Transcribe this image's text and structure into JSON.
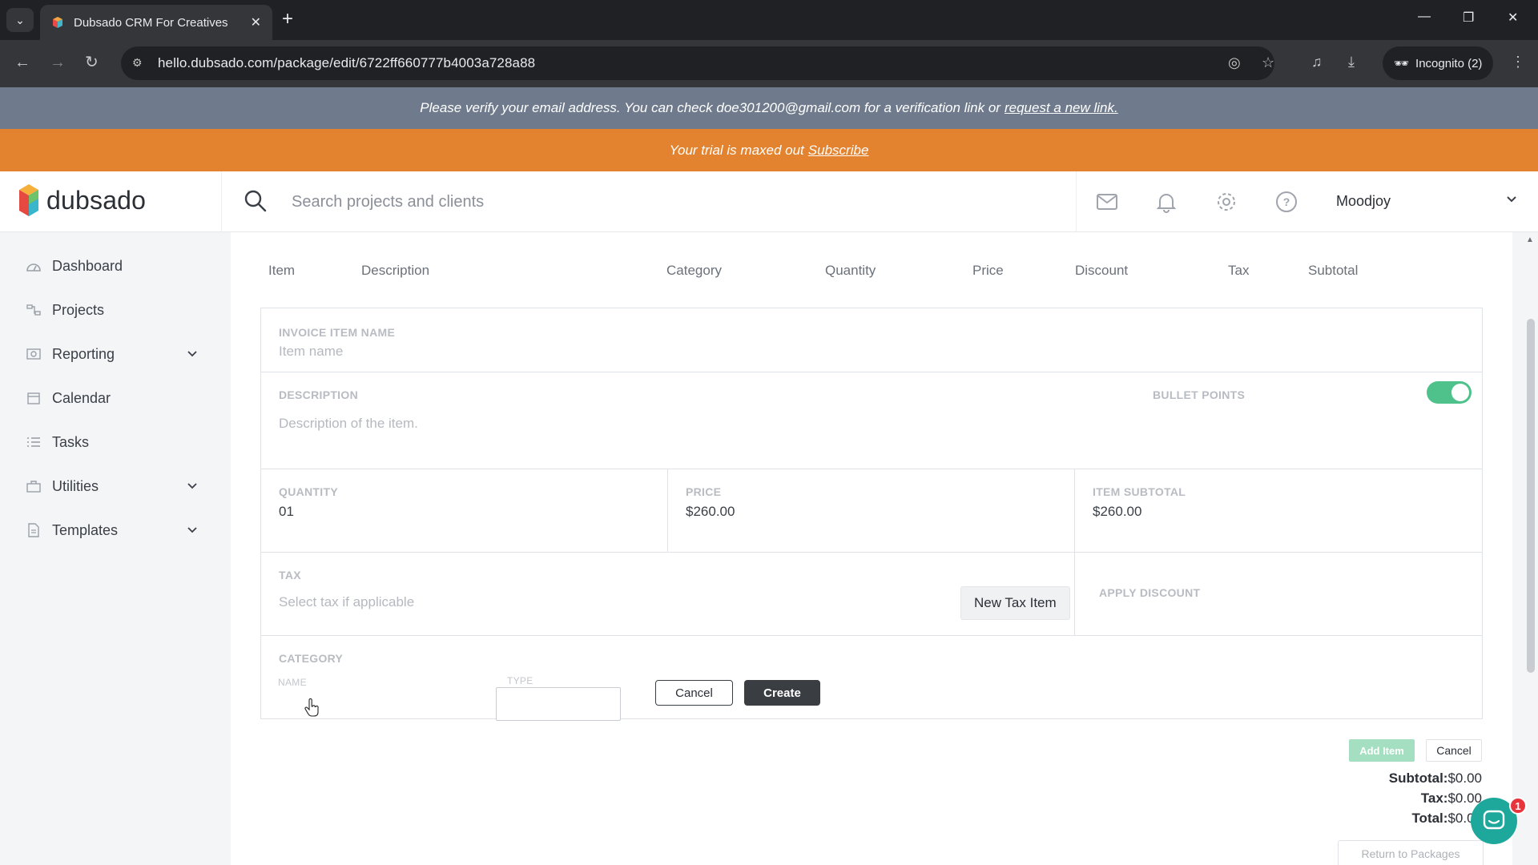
{
  "browser": {
    "tab_title": "Dubsado CRM For Creatives",
    "url": "hello.dubsado.com/package/edit/6722ff660777b4003a728a88",
    "incognito_label": "Incognito (2)"
  },
  "banners": {
    "verify_text": "Please verify your email address. You can check doe301200@gmail.com for a verification link or",
    "verify_link": "request a new link.",
    "trial_text": "Your trial is maxed out",
    "trial_link": "Subscribe"
  },
  "header": {
    "logo_text": "dubsado",
    "search_placeholder": "Search projects and clients",
    "user_name": "Moodjoy"
  },
  "sidebar": {
    "items": [
      {
        "label": "Dashboard",
        "icon": "dashboard-icon"
      },
      {
        "label": "Projects",
        "icon": "projects-icon"
      },
      {
        "label": "Reporting",
        "icon": "reporting-icon",
        "expandable": true
      },
      {
        "label": "Calendar",
        "icon": "calendar-icon"
      },
      {
        "label": "Tasks",
        "icon": "tasks-icon"
      },
      {
        "label": "Utilities",
        "icon": "utilities-icon",
        "expandable": true
      },
      {
        "label": "Templates",
        "icon": "templates-icon",
        "expandable": true
      }
    ]
  },
  "table": {
    "columns": [
      "Item",
      "Description",
      "Category",
      "Quantity",
      "Price",
      "Discount",
      "Tax",
      "Subtotal"
    ]
  },
  "form": {
    "item_name_label": "INVOICE ITEM NAME",
    "item_name_placeholder": "Item name",
    "description_label": "DESCRIPTION",
    "description_placeholder": "Description of the item.",
    "bullet_points_label": "BULLET POINTS",
    "bullet_points_on": true,
    "quantity_label": "QUANTITY",
    "quantity_value": "01",
    "price_label": "PRICE",
    "price_value": "$260.00",
    "item_subtotal_label": "ITEM SUBTOTAL",
    "item_subtotal_value": "$260.00",
    "tax_label": "TAX",
    "tax_placeholder": "Select tax if applicable",
    "new_tax_button": "New Tax Item",
    "apply_discount_label": "APPLY DISCOUNT",
    "category_label": "CATEGORY",
    "category_name_label": "NAME",
    "category_type_label": "TYPE",
    "cancel_button": "Cancel",
    "create_button": "Create"
  },
  "actions": {
    "add_item": "Add Item",
    "cancel": "Cancel",
    "return_to_packages": "Return to Packages"
  },
  "totals": {
    "subtotal_label": "Subtotal:",
    "subtotal_value": "$0.00",
    "tax_label": "Tax:",
    "tax_value": "$0.00",
    "total_label": "Total:",
    "total_value": "$0.00"
  },
  "chat": {
    "badge_count": "1"
  },
  "colors": {
    "trial_banner": "#e3832f",
    "verify_banner": "#6f7b8c",
    "toggle_on": "#4ec28a",
    "chat": "#1da89b"
  }
}
